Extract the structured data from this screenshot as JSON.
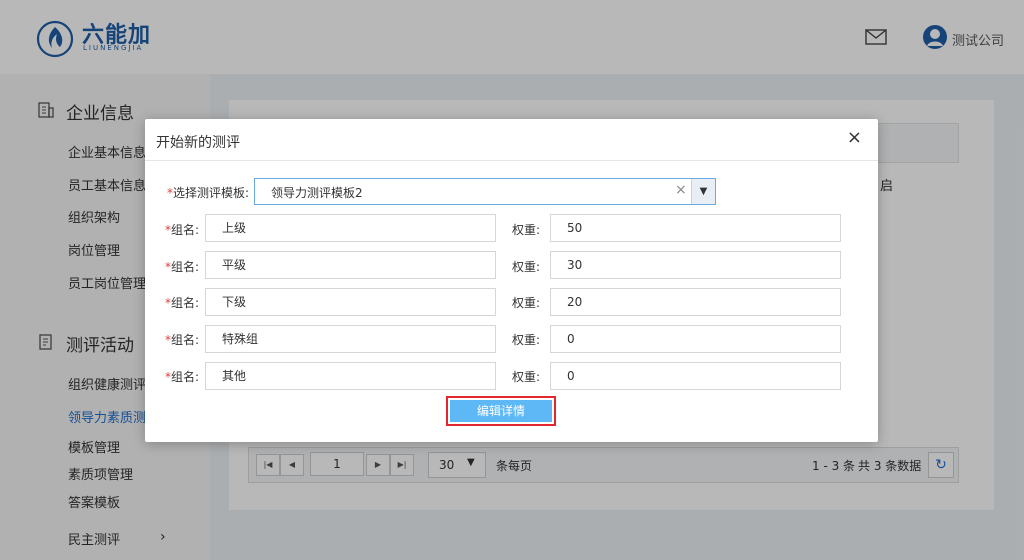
{
  "header": {
    "logo_text": "六能加",
    "logo_sub": "LIUNENGJIA",
    "company": "测试公司"
  },
  "sidebar": {
    "section1": "企业信息",
    "items1": [
      "企业基本信息",
      "员工基本信息",
      "组织架构",
      "岗位管理",
      "员工岗位管理"
    ],
    "section2": "测评活动",
    "items2": [
      "组织健康测评",
      "领导力素质测",
      "模板管理",
      "素质项管理",
      "答案模板"
    ],
    "items3": [
      "民主测评"
    ],
    "expand_arrow": "›"
  },
  "table": {
    "header_tail": "启"
  },
  "pager": {
    "first": "|◀",
    "prev": "◀",
    "page": "1",
    "next": "▶",
    "last": "▶|",
    "size": "30",
    "size_caret": "▼",
    "per_page": "条每页",
    "range": "1 - 3 条",
    "total": "共 3 条数据",
    "refresh": "↻"
  },
  "modal": {
    "title": "开始新的测评",
    "close": "×",
    "template_label": "选择测评模板:",
    "required_mark": "*",
    "template_value": "领导力测评模板2",
    "clear": "×",
    "caret": "▼",
    "group_label": "组名:",
    "weight_label": "权重:",
    "groups": [
      {
        "name": "上级",
        "weight": "50"
      },
      {
        "name": "平级",
        "weight": "30"
      },
      {
        "name": "下级",
        "weight": "20"
      },
      {
        "name": "特殊组",
        "weight": "0"
      },
      {
        "name": "其他",
        "weight": "0"
      }
    ],
    "button": "编辑详情"
  },
  "colors": {
    "brand": "#1f5fa8",
    "active": "#1e6fd0",
    "button": "#5fb8f6",
    "highlight": "#e0282e"
  }
}
